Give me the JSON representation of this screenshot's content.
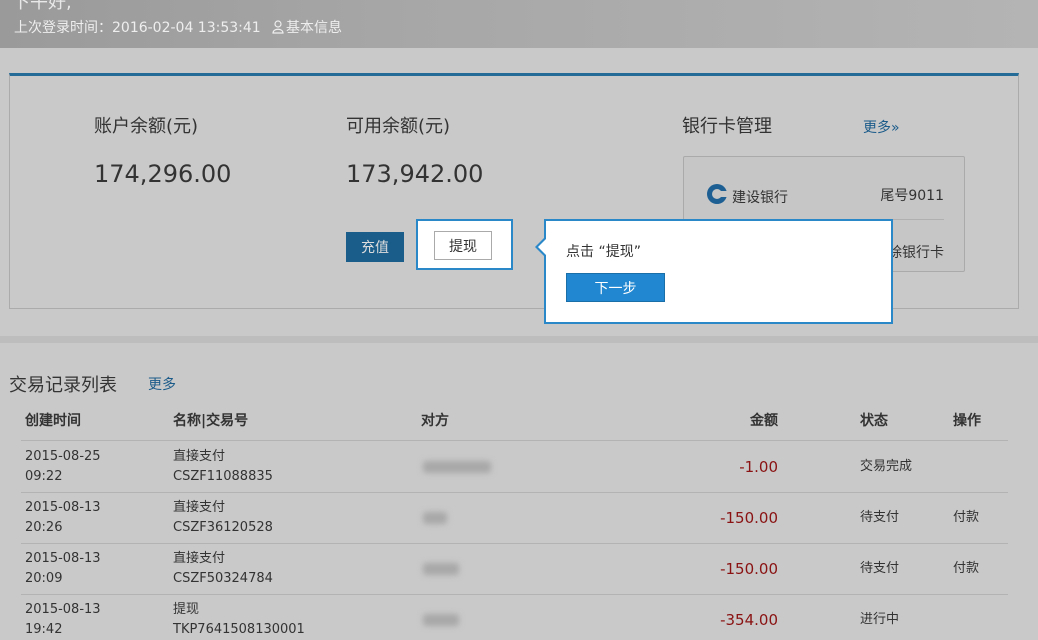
{
  "header": {
    "greeting": "下午好,",
    "last_login": "上次登录时间：2016-02-04 13:53:41",
    "basic_info": "基本信息"
  },
  "account": {
    "balance_label": "账户余额(元)",
    "balance_value": "174,296.00",
    "available_label": "可用余额(元)",
    "available_value": "173,942.00",
    "recharge_label": "充值",
    "withdraw_label": "提现"
  },
  "bank": {
    "title": "银行卡管理",
    "more": "更多»",
    "bank_name": "建设银行",
    "card_tail": "尾号9011",
    "delete_label": "删除银行卡"
  },
  "tooltip": {
    "text": "点击 “提现”",
    "next_label": "下一步"
  },
  "transactions": {
    "title": "交易记录列表",
    "more": "更多",
    "columns": [
      "创建时间",
      "名称|交易号",
      "对方",
      "金额",
      "状态",
      "操作"
    ],
    "rows": [
      {
        "date": "2015-08-25",
        "time": "09:22",
        "name": "直接支付",
        "no": "CSZF11088835",
        "amount": "-1.00",
        "status": "交易完成",
        "action": ""
      },
      {
        "date": "2015-08-13",
        "time": "20:26",
        "name": "直接支付",
        "no": "CSZF36120528",
        "amount": "-150.00",
        "status": "待支付",
        "action": "付款"
      },
      {
        "date": "2015-08-13",
        "time": "20:09",
        "name": "直接支付",
        "no": "CSZF50324784",
        "amount": "-150.00",
        "status": "待支付",
        "action": "付款"
      },
      {
        "date": "2015-08-13",
        "time": "19:42",
        "name": "提现",
        "no": "TKP7641508130001",
        "amount": "-354.00",
        "status": "进行中",
        "action": ""
      }
    ]
  },
  "colors": {
    "accent": "#246b98",
    "highlight_border": "#2a88c8",
    "next_button": "#2187d0",
    "amount_negative": "#8a1212"
  }
}
